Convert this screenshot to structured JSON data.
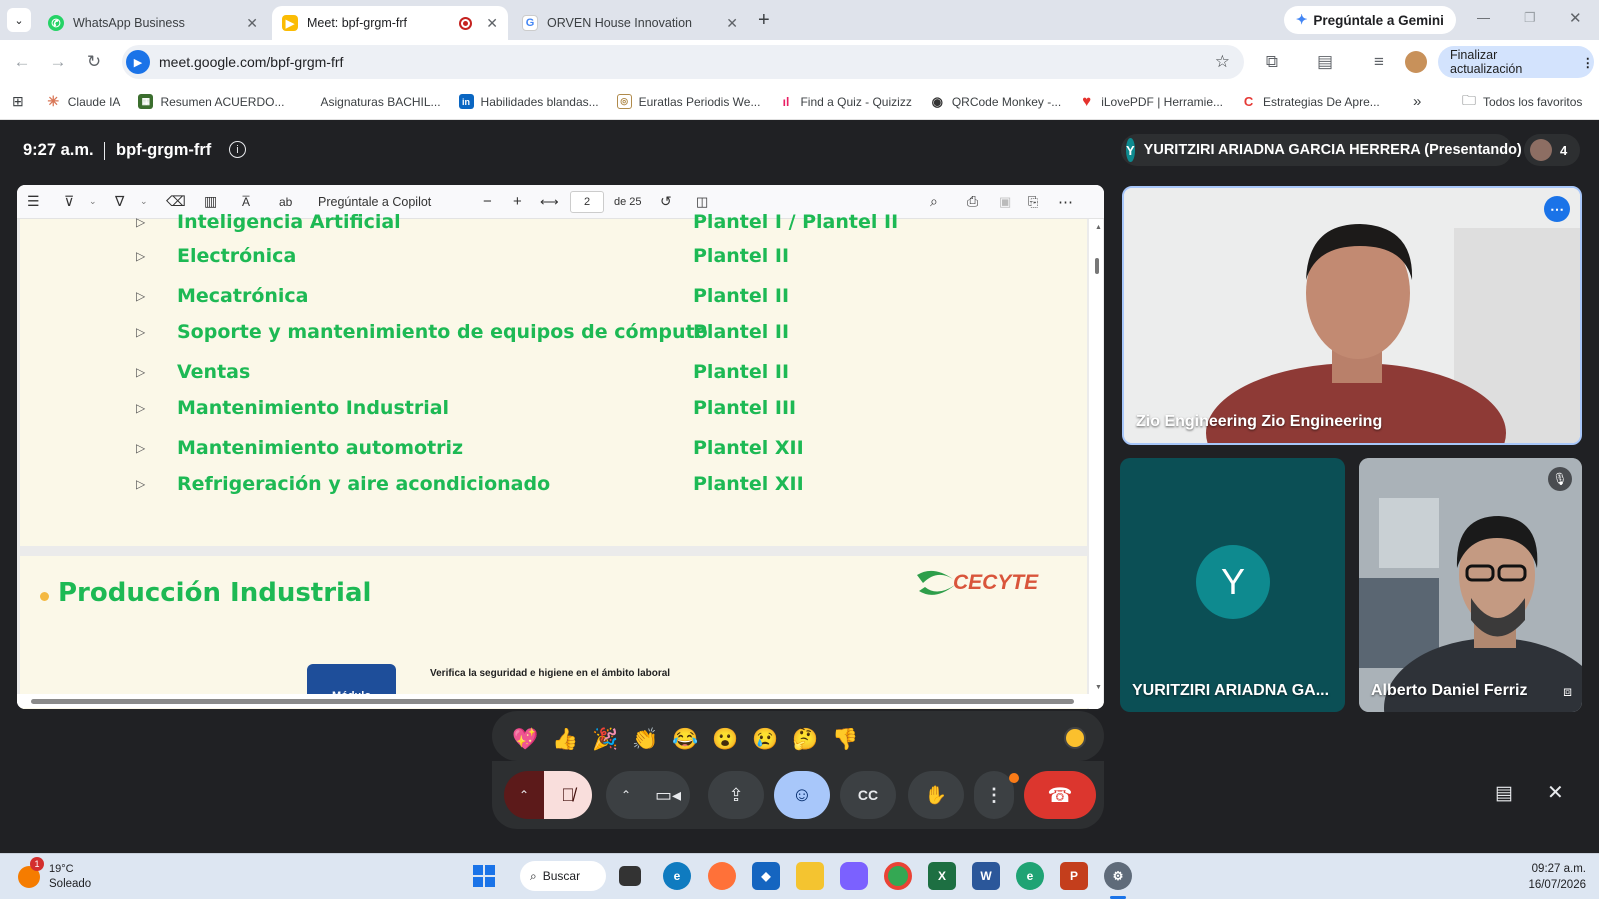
{
  "browser": {
    "tabs": [
      {
        "title": "WhatsApp Business",
        "active": false
      },
      {
        "title": "Meet: bpf-grgm-frf",
        "active": true
      },
      {
        "title": "ORVEN House Innovation",
        "active": false
      }
    ],
    "gemini_label": "Pregúntale a Gemini",
    "url": "meet.google.com/bpf-grgm-frf",
    "update_label": "Finalizar actualización",
    "bookmarks": [
      "Claude IA",
      "Resumen ACUERDO...",
      "Asignaturas BACHIL...",
      "Habilidades blandas...",
      "Euratlas Periodis We...",
      "Find a Quiz - Quizizz",
      "QRCode Monkey -...",
      "iLovePDF | Herramie...",
      "Estrategias De Apre..."
    ],
    "all_bookmarks": "Todos los favoritos"
  },
  "meet": {
    "time": "9:27 a.m.",
    "code": "bpf-grgm-frf",
    "presenter_initial": "Y",
    "presenter_label": "YURITZIRI ARIADNA GARCIA HERRERA (Presentando)",
    "participant_count": "4",
    "participants": [
      {
        "name": "Zio Engineering Zio Engineering"
      },
      {
        "name": "YURITZIRI ARIADNA GA...",
        "initial": "Y"
      },
      {
        "name": "Alberto Daniel Ferriz"
      }
    ],
    "reactions": [
      "💖",
      "👍",
      "🎉",
      "👏",
      "😂",
      "😮",
      "😢",
      "🤔",
      "👎"
    ]
  },
  "pdf": {
    "copilot_label": "Pregúntale a Copilot",
    "page_number": "2",
    "page_total": "de 25",
    "rows": [
      {
        "career": "Inteligencia Artificial",
        "plantel": "Plantel I / Plantel II"
      },
      {
        "career": "Electrónica",
        "plantel": "Plantel II"
      },
      {
        "career": "Mecatrónica",
        "plantel": "Plantel II"
      },
      {
        "career": "Soporte y mantenimiento de equipos de cómputo",
        "plantel": "Plantel II"
      },
      {
        "career": "Ventas",
        "plantel": "Plantel II"
      },
      {
        "career": "Mantenimiento Industrial",
        "plantel": "Plantel  III"
      },
      {
        "career": "Mantenimiento automotriz",
        "plantel": "Plantel XII"
      },
      {
        "career": "Refrigeración y aire acondicionado",
        "plantel": "Plantel XII"
      }
    ],
    "section_title": "Producción Industrial",
    "logo_text": "CECYTE",
    "module_label": "Módulo",
    "module_text": "Verifica la seguridad e higiene en el ámbito laboral"
  },
  "taskbar": {
    "weather_temp": "19°C",
    "weather_desc": "Soleado",
    "weather_badge": "1",
    "search_label": "Buscar",
    "clock_time": "09:27 a.m.",
    "clock_date": "16/07/2026"
  }
}
